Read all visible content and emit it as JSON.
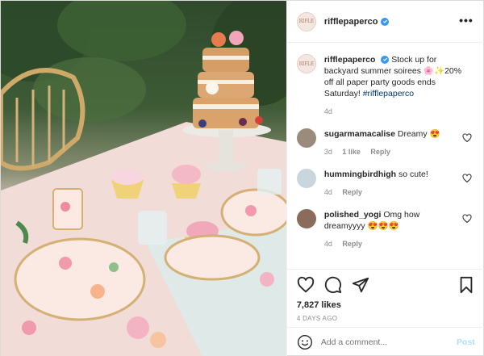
{
  "photo": {
    "alt": ""
  },
  "header": {
    "username": "rifflepaperco",
    "avatar_text": "RIFLE",
    "more": "•••"
  },
  "caption": {
    "username": "rifflepaperco",
    "text": "Stock up for backyard summer soirees 🌸✨20% off all paper party goods ends Saturday!",
    "hashtag": "#rifflepaperco",
    "time": "4d"
  },
  "comments": [
    {
      "username": "sugarmamacalise",
      "text": "Dreamy 😍",
      "time": "3d",
      "likes": "1 like",
      "reply": "Reply",
      "avatar_color": "#9b8b7a"
    },
    {
      "username": "hummingbirdhigh",
      "text": "so cute!",
      "time": "4d",
      "likes": "",
      "reply": "Reply",
      "avatar_color": "#c9d6de"
    },
    {
      "username": "polished_yogi",
      "text": "Omg how dreamyyyy 😍😍😍",
      "time": "4d",
      "likes": "",
      "reply": "Reply",
      "avatar_color": "#8a6b5c"
    }
  ],
  "actions": {
    "likes": "7,827 likes",
    "posted": "4 DAYS AGO"
  },
  "add_comment": {
    "placeholder": "Add a comment...",
    "post_label": "Post"
  },
  "colors": {
    "verified": "#3897f0",
    "link": "#00376b",
    "post_disabled": "#b2dffc"
  }
}
